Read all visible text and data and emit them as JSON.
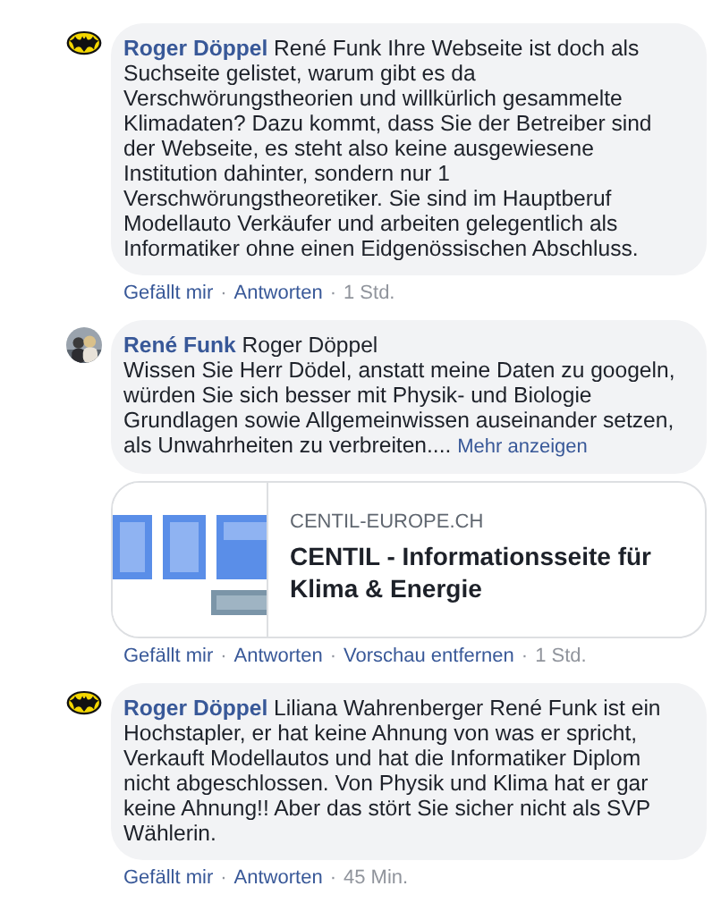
{
  "comments": [
    {
      "avatar": {
        "kind": "emblem"
      },
      "author": "Roger Döppel",
      "text": "René Funk Ihre Webseite ist doch als Suchseite gelistet, warum gibt es da Verschwörungstheorien und willkürlich gesammelte Klimadaten? Dazu kommt, dass Sie der Betreiber sind der Webseite, es steht also keine ausgewiesene Institution dahinter, sondern nur 1 Verschwörungstheoretiker. Sie sind im Hauptberuf Modellauto Verkäufer und arbeiten gelegentlich als Informatiker ohne einen Eidgenössischen Abschluss.",
      "actions": [
        {
          "kind": "link",
          "label": "Gefällt mir"
        },
        {
          "kind": "separator",
          "label": "·"
        },
        {
          "kind": "link",
          "label": "Antworten"
        },
        {
          "kind": "separator",
          "label": "·"
        },
        {
          "kind": "time",
          "label": "1 Std."
        }
      ]
    },
    {
      "author": "René Funk",
      "text": "Roger Döppel\nWissen Sie Herr Dödel, anstatt meine Daten zu googeln, würden Sie sich besser mit Physik- und Biologie Grundlagen sowie Allgemeinwissen auseinander setzen, als Unwahrheiten zu verbreiten....",
      "more_link": "Mehr anzeigen",
      "link_preview": {
        "kind": "picture",
        "domain": "CENTIL-EUROPE.CH",
        "title": "CENTIL - Informationsseite für Klima & Energie"
      },
      "actions": [
        {
          "kind": "link",
          "label": "Gefällt mir"
        },
        {
          "kind": "separator",
          "label": "·"
        },
        {
          "kind": "link",
          "label": "Antworten"
        },
        {
          "kind": "separator",
          "label": "·"
        },
        {
          "kind": "link",
          "label": "Vorschau entfernen"
        },
        {
          "kind": "separator",
          "label": "·"
        },
        {
          "kind": "time",
          "label": "1 Std."
        }
      ]
    },
    {
      "avatar": {
        "kind": "emblem"
      },
      "author": "Roger Döppel",
      "text": "Liliana Wahrenberger René Funk ist ein Hochstapler, er hat keine Ahnung von was er spricht, Verkauft Modellautos und hat die Informatiker Diplom nicht abgeschlossen. Von Physik und Klima hat er gar keine Ahnung!! Aber das stört Sie sicher nicht als SVP Wählerin.",
      "actions": [
        {
          "kind": "link",
          "label": "Gefällt mir"
        },
        {
          "kind": "separator",
          "label": "·"
        },
        {
          "kind": "link",
          "label": "Antworten"
        },
        {
          "kind": "separator",
          "label": "·"
        },
        {
          "kind": "time",
          "label": "45 Min."
        }
      ]
    }
  ]
}
